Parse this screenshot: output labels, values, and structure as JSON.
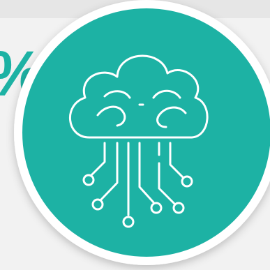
{
  "background_text": "%",
  "icon": {
    "name": "cloud-brain-circuit-icon"
  },
  "colors": {
    "page_bg": "#f2f2f2",
    "badge_fill": "#1db2a4",
    "badge_ring": "#ffffff",
    "line": "#ffffff",
    "text_accent": "#1db2a4"
  }
}
